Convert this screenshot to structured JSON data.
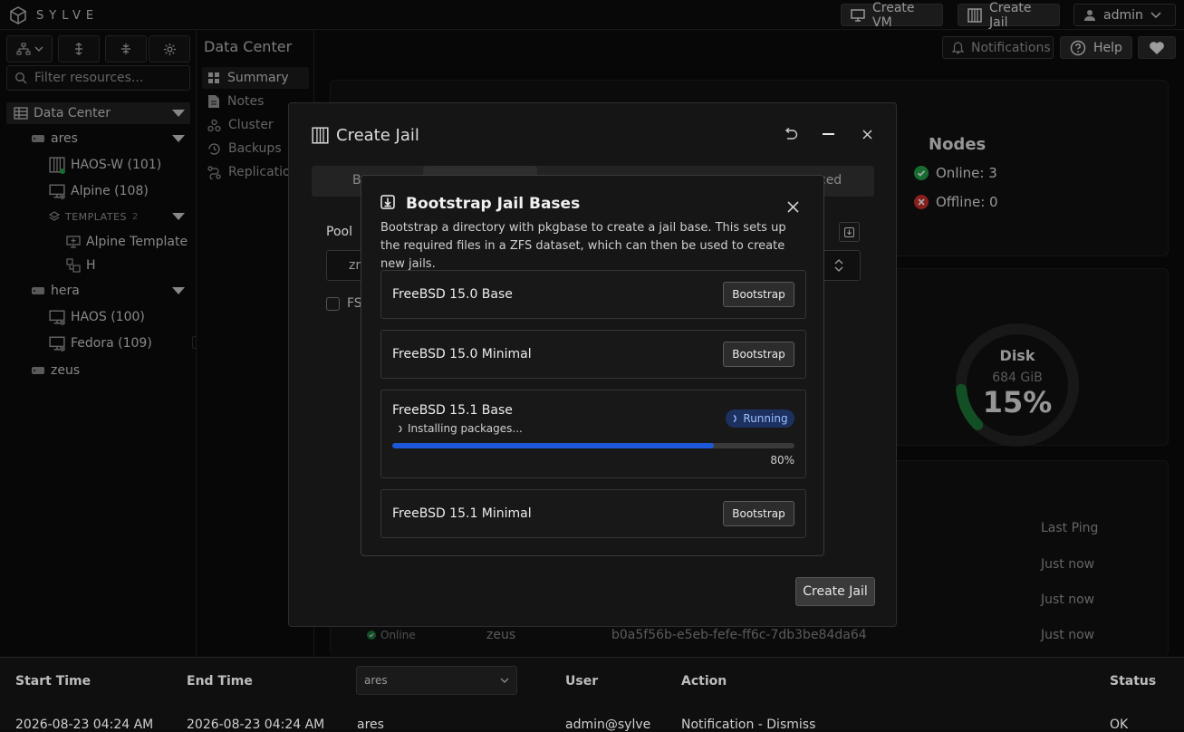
{
  "topbar": {
    "logo_text": "SYLVE",
    "create_vm_label": "Create VM",
    "create_jail_label": "Create Jail",
    "user_label": "admin"
  },
  "sidebar": {
    "filter_placeholder": "Filter resources...",
    "tree": {
      "root": "Data Center",
      "nodes": [
        {
          "name": "ares",
          "items": [
            "HAOS-W (101)",
            "Alpine (108)"
          ],
          "templates_label": "TEMPLATES",
          "templates_count": "2",
          "templates": [
            "Alpine Template",
            "H"
          ]
        },
        {
          "name": "hera",
          "items": [
            "HAOS (100)",
            "Fedora (109)"
          ]
        },
        {
          "name": "zeus",
          "items": []
        }
      ]
    }
  },
  "header": {
    "title": "Data Center",
    "notifications_label": "Notifications",
    "help_label": "Help"
  },
  "subnav": {
    "items": [
      "Summary",
      "Notes",
      "Cluster",
      "Backups",
      "Replication"
    ]
  },
  "summary": {
    "nodes_title": "Nodes",
    "online_label": "Online: 3",
    "offline_label": "Offline: 0",
    "disk_label": "Disk",
    "disk_size": "684 GiB",
    "disk_percent": "15%",
    "disk_fraction": 0.15,
    "last_ping_header": "Last Ping",
    "pings": [
      "Just now",
      "Just now",
      "Just now"
    ],
    "row_status": "Online",
    "row_node": "zeus",
    "row_id": "b0a5f56b-e5eb-fefe-ff6c-7db3be84da64"
  },
  "create_jail": {
    "title": "Create Jail",
    "tab_first_fragment": "B",
    "tab_last_fragment": "ced",
    "pool_label": "Pool",
    "pool_value_fragment": "zr",
    "checkbox_fragment": "FS",
    "submit_label": "Create Jail"
  },
  "bootstrap": {
    "title": "Bootstrap Jail Bases",
    "description": "Bootstrap a directory with pkgbase to create a jail base. This sets up the required files in a ZFS dataset, which can then be used to create new jails.",
    "bases": [
      {
        "name": "FreeBSD 15.0 Base",
        "button": "Bootstrap"
      },
      {
        "name": "FreeBSD 15.0 Minimal",
        "button": "Bootstrap"
      },
      {
        "name": "FreeBSD 15.1 Base",
        "status": "Running",
        "step": "Installing packages...",
        "progress": 0.8,
        "progress_label": "80%"
      },
      {
        "name": "FreeBSD 15.1 Minimal",
        "button": "Bootstrap"
      }
    ]
  },
  "audit": {
    "headers": [
      "Start Time",
      "End Time",
      "User",
      "Action",
      "Status"
    ],
    "node_filter": "ares",
    "row": [
      "2026-08-23 04:24 AM",
      "2026-08-23 04:24 AM",
      "ares",
      "admin@sylve",
      "Notification - Dismiss",
      "OK"
    ]
  },
  "colors": {
    "accent": "#1d58d8",
    "online": "#22a84a",
    "offline": "#d0312d"
  }
}
